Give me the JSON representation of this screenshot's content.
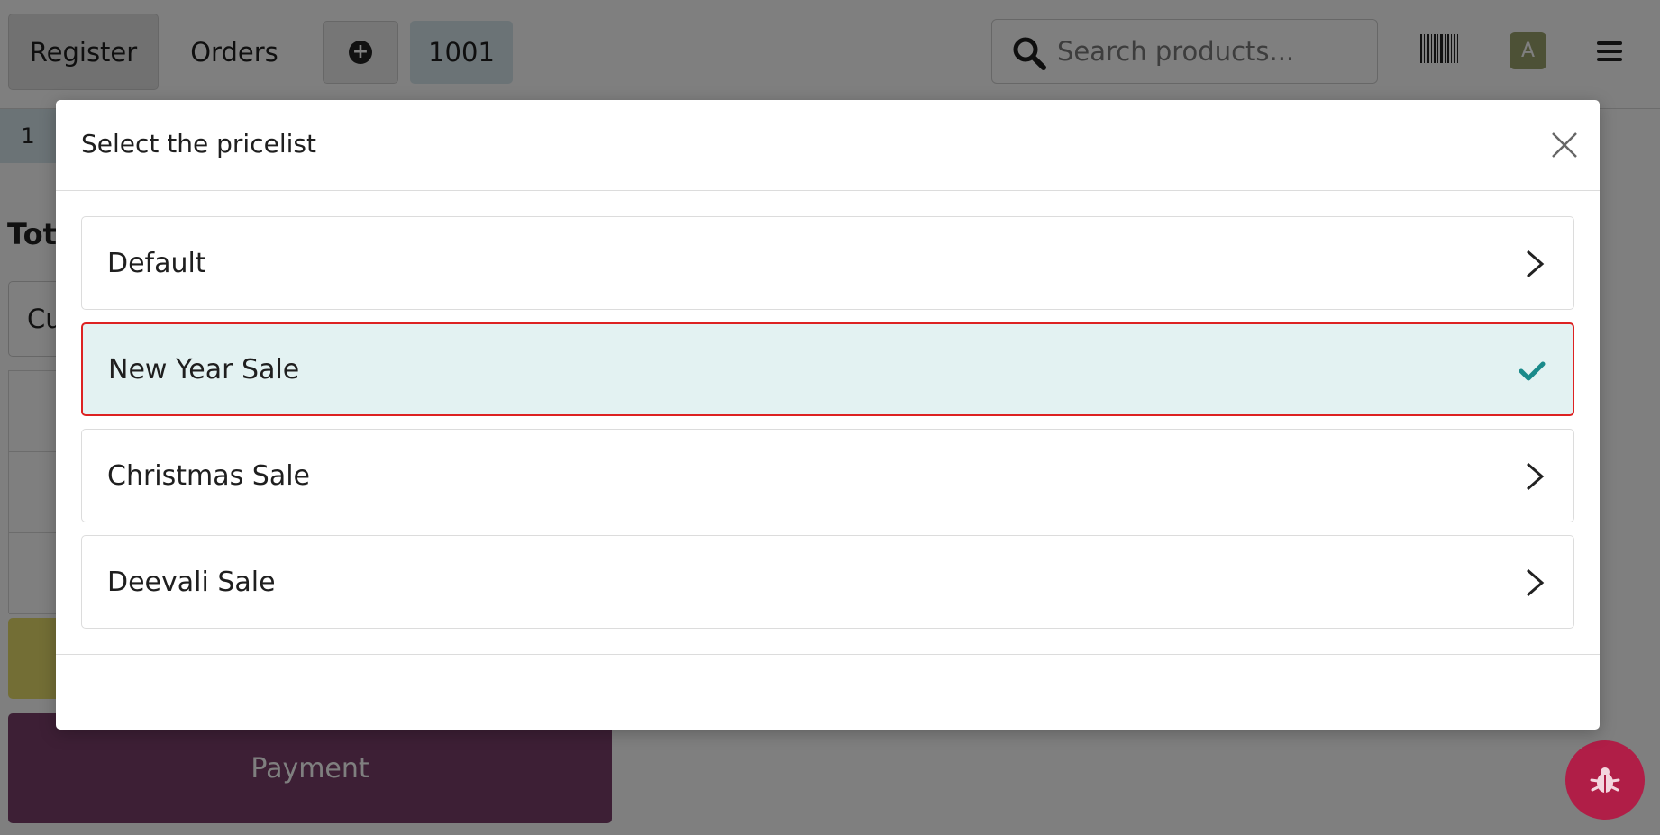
{
  "navbar": {
    "register_label": "Register",
    "orders_label": "Orders",
    "order_number": "1001",
    "search": {
      "placeholder": "Search products..."
    },
    "avatar_initial": "A",
    "icons": [
      "plus-circle-icon",
      "search-icon",
      "barcode-icon",
      "hamburger-icon"
    ]
  },
  "left_pane": {
    "order_tab": "1",
    "total_label": "Tota",
    "customer_label": "Cu",
    "payment_label": "Payment"
  },
  "modal": {
    "title": "Select the pricelist",
    "pricelists": [
      {
        "label": "Default",
        "selected": false
      },
      {
        "label": "New Year Sale",
        "selected": true
      },
      {
        "label": "Christmas Sale",
        "selected": false
      },
      {
        "label": "Deevali Sale",
        "selected": false
      }
    ]
  },
  "colors": {
    "payment": "#7a3f6b",
    "selected_bg": "#e3f2f2",
    "selected_border": "#dd2222",
    "check": "#1a8a8a",
    "debug_fab": "#b01e47"
  },
  "debug_icon": "bug-icon"
}
